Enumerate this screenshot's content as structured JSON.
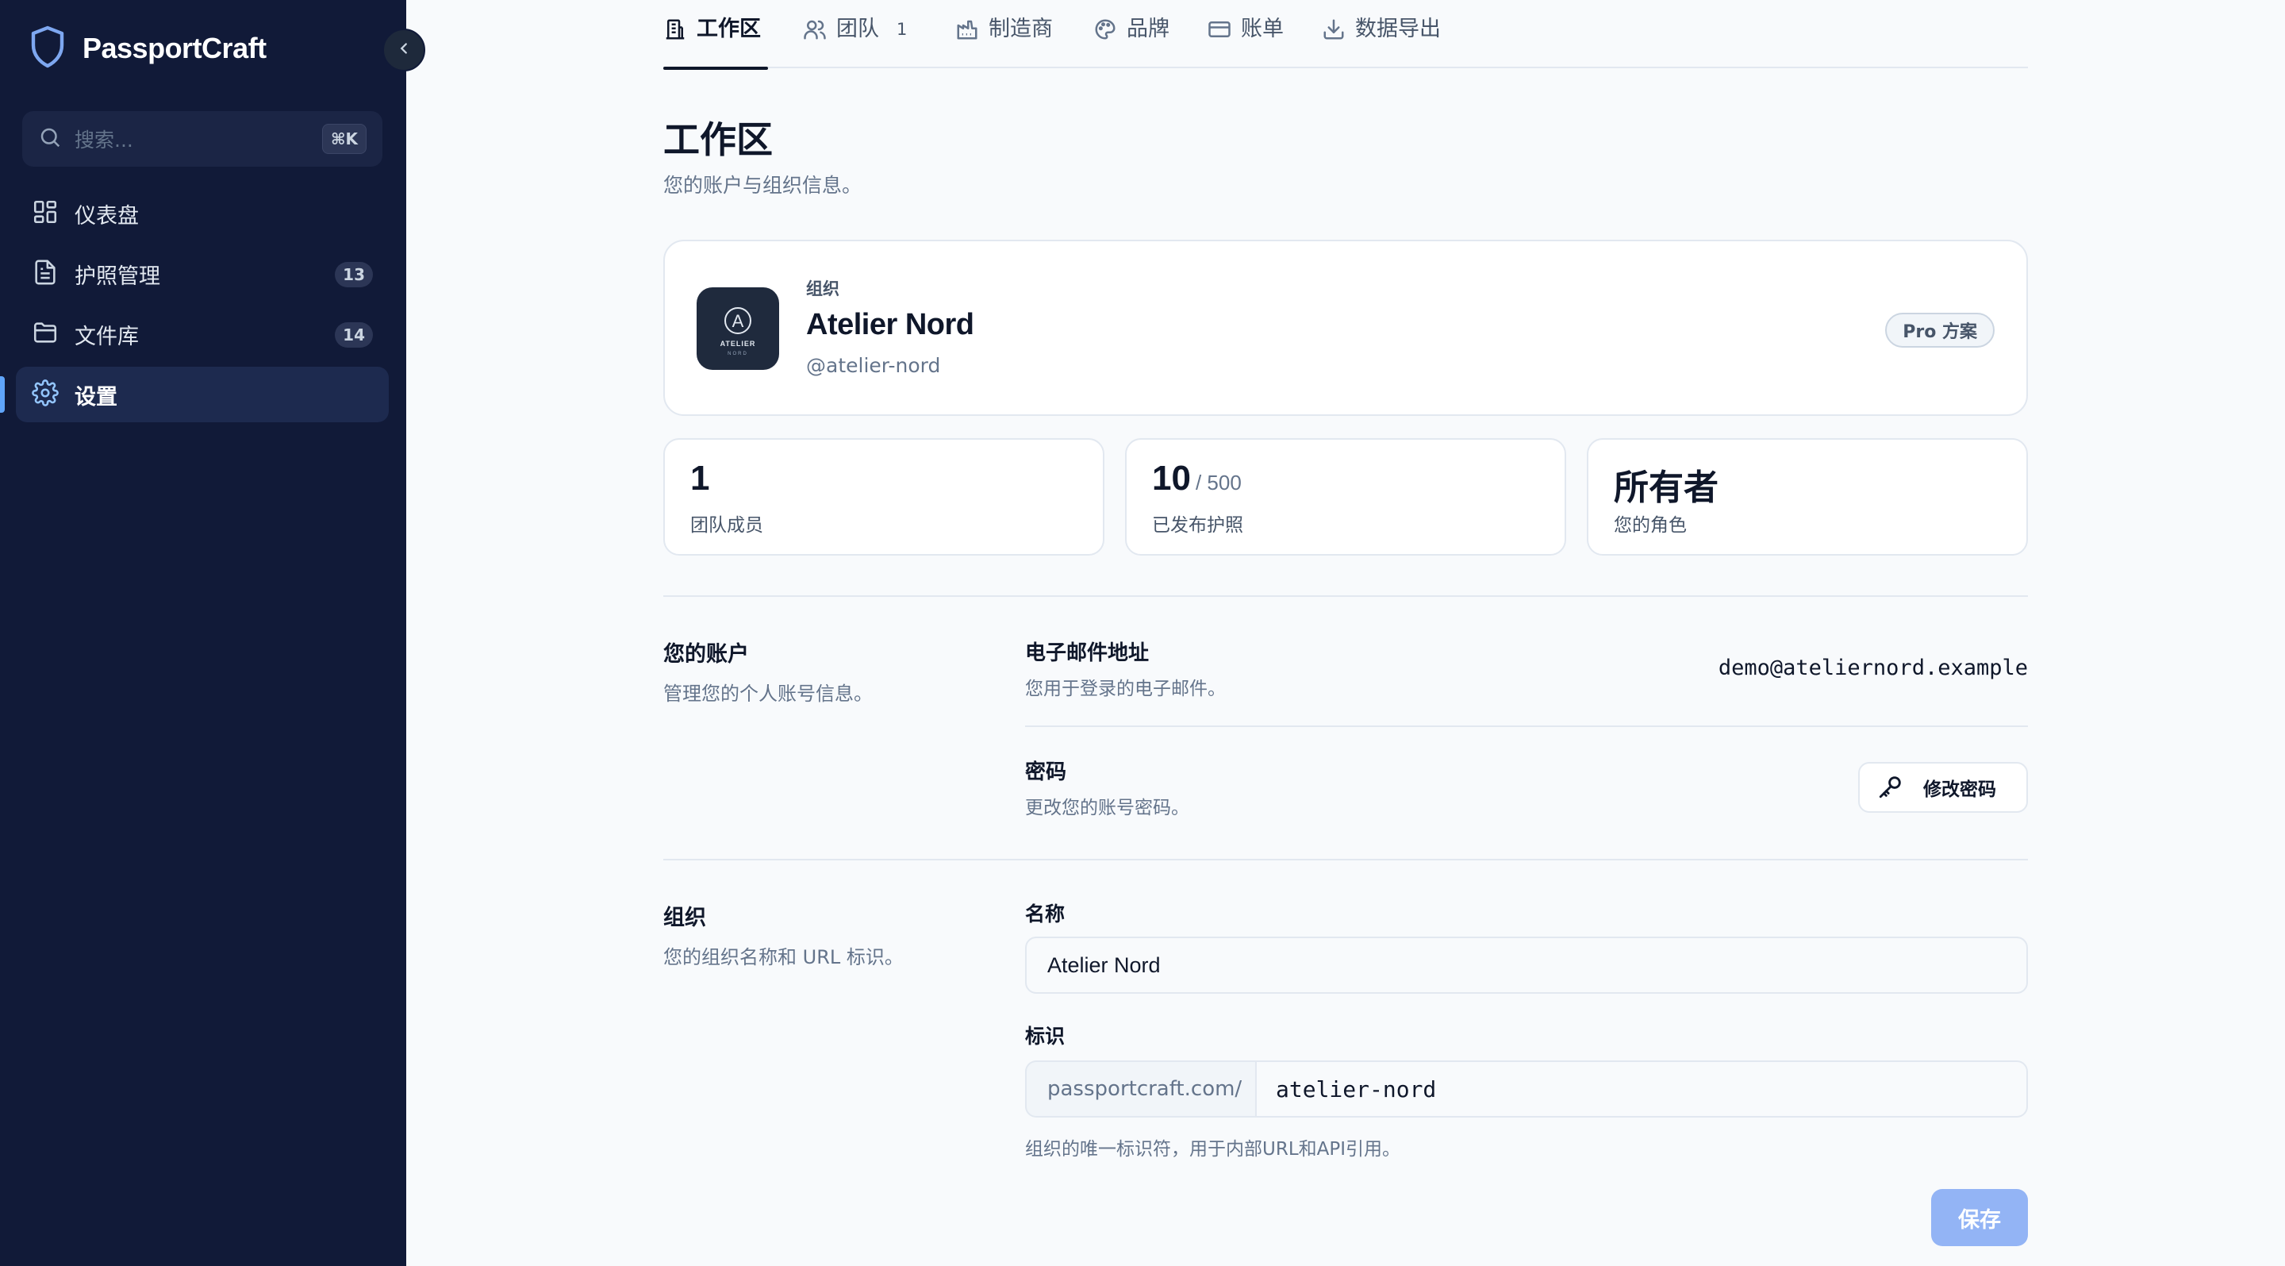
{
  "app": {
    "name": "PassportCraft"
  },
  "sidebar": {
    "search_placeholder": "搜索...",
    "search_shortcut": "⌘K",
    "items": [
      {
        "label": "仪表盘",
        "icon": "dashboard-icon",
        "badge": ""
      },
      {
        "label": "护照管理",
        "icon": "document-icon",
        "badge": "13"
      },
      {
        "label": "文件库",
        "icon": "folder-icon",
        "badge": "14"
      },
      {
        "label": "设置",
        "icon": "gear-icon",
        "badge": "",
        "active": true
      }
    ]
  },
  "tabs": [
    {
      "label": "工作区",
      "icon": "building-icon",
      "active": true
    },
    {
      "label": "团队",
      "icon": "users-icon",
      "count": "1"
    },
    {
      "label": "制造商",
      "icon": "factory-icon"
    },
    {
      "label": "品牌",
      "icon": "palette-icon"
    },
    {
      "label": "账单",
      "icon": "credit-card-icon"
    },
    {
      "label": "数据导出",
      "icon": "download-icon"
    }
  ],
  "page": {
    "title": "工作区",
    "subtitle": "您的账户与组织信息。"
  },
  "org_card": {
    "kicker": "组织",
    "name": "Atelier Nord",
    "handle": "@atelier-nord",
    "plan": "Pro 方案",
    "logo_text": "ATELIER",
    "logo_subtext": "NORD",
    "logo_letter": "A"
  },
  "stats": [
    {
      "value": "1",
      "of": "",
      "label": "团队成员"
    },
    {
      "value": "10",
      "of": "/ 500",
      "label": "已发布护照"
    },
    {
      "value": "所有者",
      "of": "",
      "label": "您的角色"
    }
  ],
  "account_section": {
    "title": "您的账户",
    "desc": "管理您的个人账号信息。",
    "email_title": "电子邮件地址",
    "email_desc": "您用于登录的电子邮件。",
    "email_value": "demo@ateliernord.example",
    "password_title": "密码",
    "password_desc": "更改您的账号密码。",
    "password_button": "修改密码"
  },
  "org_section": {
    "title": "组织",
    "desc": "您的组织名称和 URL 标识。",
    "name_label": "名称",
    "name_value": "Atelier Nord",
    "slug_label": "标识",
    "slug_prefix": "passportcraft.com/",
    "slug_value": "atelier-nord",
    "slug_hint": "组织的唯一标识符，用于内部URL和API引用。",
    "save_button": "保存"
  },
  "colors": {
    "sidebar_bg": "#111a38",
    "page_bg": "#f8fafc",
    "accent": "#60a5fa",
    "save_button": "#93b4f5"
  }
}
